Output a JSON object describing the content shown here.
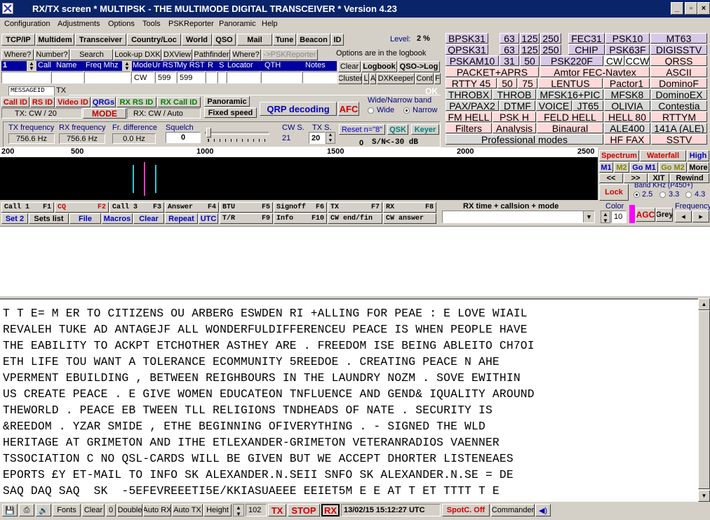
{
  "window": {
    "title": "RX/TX screen  * MULTIPSK - THE MULTIMODE DIGITAL TRANSCEIVER *   Version 4.23"
  },
  "menu": [
    "Configuration",
    "Adjustments",
    "Options",
    "Tools",
    "PSKReporter",
    "Panoramic",
    "Help"
  ],
  "toolbar1": [
    "TCP/IP",
    "Multidem",
    "Transceiver",
    "Country/Loc",
    "World",
    "QSO",
    "Mail",
    "Tune",
    "Beacon",
    "ID"
  ],
  "level": {
    "label": "Level:",
    "value": "2 %"
  },
  "toolbar2": [
    "Where?",
    "Number?",
    "Search",
    "Look-up DXK",
    "DXView",
    "Pathfinder",
    "Where?",
    "->PSKReporter"
  ],
  "logbook_note": "Options are in the logbook",
  "log_headers": {
    "num": "1",
    "call": "Call",
    "name": "Name",
    "freq": "Freq Mhz",
    "mode": "Mode",
    "ur": "Ur RST",
    "my": "My RST",
    "r": "R",
    "s": "S",
    "locator": "Locator",
    "qth": "QTH",
    "notes": "Notes"
  },
  "log_values": {
    "mode": "CW",
    "ur": "599",
    "my": "599"
  },
  "log_buttons": {
    "clear": "Clear",
    "logbook": "Logbook",
    "qso_log": "QSO->Log",
    "cluster": "Cluster",
    "l": "L",
    "a": "A",
    "dxkeeper": "DXKeeper",
    "cont": "Cont",
    "f": "F"
  },
  "tabs": [
    "MESSAGEID",
    "TX"
  ],
  "ids": {
    "call": "Call ID",
    "rs": "RS ID",
    "video": "Video ID",
    "qrgs": "QRGs",
    "rx_rs": "RX RS ID",
    "rx_call": "RX Call ID",
    "panoramic": "Panoramic",
    "fixed": "Fixed speed"
  },
  "tx_status": "TX: CW / 20",
  "mode_btn": "MODE",
  "rx_status": "RX: CW / Auto",
  "qrp": "QRP decoding",
  "afc": "AFC",
  "band": {
    "title": "Wide/Narrow band",
    "wide": "Wide",
    "narrow": "Narrow"
  },
  "ok": "OK",
  "freq": {
    "tx_label": "TX frequency",
    "tx": "756.6 Hz",
    "rx_label": "RX frequency",
    "rx": "756.6 Hz",
    "diff_label": "Fr. difference",
    "diff": "0.0 Hz",
    "squelch_label": "Squelch",
    "squelch": "0",
    "cws_label": "CW S.",
    "cws": "21",
    "txs_label": "TX S.",
    "txs": "20",
    "reset": "Reset n=\"8\"",
    "qsk": "QSK",
    "keyer": "Keyer",
    "sn0": "0",
    "sn": "S/N<-30 dB"
  },
  "modes": [
    [
      "BPSK31",
      "63",
      "125",
      "250",
      "FEC31",
      "PSK10",
      "MT63"
    ],
    [
      "QPSK31",
      "63",
      "125",
      "250",
      "CHIP",
      "PSK63F",
      "DIGISSTV"
    ],
    [
      "PSKAM10",
      "31",
      "50",
      "PSK220F",
      "CW",
      "CCW",
      "QRSS"
    ],
    [
      "PACKET+APRS",
      "Amtor FEC-Navtex",
      "ASCII"
    ],
    [
      "RTTY 45",
      "50",
      "75",
      "LENTUS",
      "Pactor1",
      "DominoF"
    ],
    [
      "THROBX",
      "THROB",
      "MFSK16+PIC",
      "MFSK8",
      "DominoEX"
    ],
    [
      "PAX/PAX2",
      "DTMF",
      "VOICE",
      "JT65",
      "OLIVIA",
      "Contestia"
    ],
    [
      "FM HELL",
      "PSK H",
      "FELD HELL",
      "HELL 80",
      "RTTYM"
    ],
    [
      "Filters",
      "Analysis",
      "Binaural",
      "ALE400",
      "141A (ALE)"
    ],
    [
      "Professional modes",
      "HF FAX",
      "SSTV"
    ]
  ],
  "ruler": [
    "200",
    "500",
    "1000",
    "1500",
    "2000",
    "2500"
  ],
  "display": {
    "spectrum": "Spectrum",
    "waterfall": "Waterfall",
    "high": "High",
    "m1": "M1",
    "m2": "M2",
    "gom1": "Go M1",
    "gom2": "Go M2",
    "more": "More",
    "left": "<<",
    "right": ">>",
    "xit": "XIT",
    "rewind": "Rewind",
    "lock": "Lock",
    "bandkhz": "Band KHz (P450+)",
    "b25": "2.5",
    "b33": "3.3",
    "b43": "4.3",
    "color": "Color",
    "color_val": "10",
    "agc": "AGC",
    "grey": "Grey",
    "frequency": "Frequency"
  },
  "fkeys": [
    {
      "l": "Call  1",
      "r": "F1"
    },
    {
      "l": "CQ",
      "r": "F2"
    },
    {
      "l": "Call  3",
      "r": "F3"
    },
    {
      "l": "Answer",
      "r": "F4"
    },
    {
      "l": "BTU",
      "r": "F5"
    },
    {
      "l": "Signoff",
      "r": "F6"
    },
    {
      "l": "TX",
      "r": "F7"
    },
    {
      "l": "RX",
      "r": "F8"
    },
    {
      "l": "T/R",
      "r": "F9"
    },
    {
      "l": "Info",
      "r": "F10"
    },
    {
      "l": "CW end/fin",
      "r": ""
    },
    {
      "l": "CW answer",
      "r": ""
    }
  ],
  "bottom_btns": {
    "set2": "Set 2",
    "sets": "Sets list",
    "file": "File",
    "macros": "Macros",
    "clear": "Clear",
    "repeat": "Repeat",
    "utc": "UTC"
  },
  "rx_time": "RX time + callsion + mode",
  "rx_text": [
    "T T E= M ER TO CITIZENS OU ARBERG ESWDEN RI +ALLING FOR PEAE : E LOVE WIAIL",
    "REVALEH TUKE AD ANTAGEJF ALL WONDERFULDIFFERENCEU PEACE IS WHEN PEOPLE HAVE",
    "THE EABILITY TO ACKPT ETCHOTHER ASTHEY ARE . FREEDOM ISE BEING ABLEITO CH7OI",
    "ETH LIFE TOU WANT A TOLERANCE ECOMMUNITY 5REEDOE . CREATING PEACE N AHE",
    "VPERMENT EBUILDING , BETWEEN REIGHBOURS IN THE LAUNDRY NOZM . SOVE EWITHIN",
    "US CREATE PEACE . E GIVE WOMEN EDUCATEON TNFLUENCE AND GEND& IQUALITY AROUND",
    "THEWORLD . PEACE EB TWEEN TLL RELIGIONS TNDHEADS OF NATE . SECURITY IS",
    "&REEDOM . YZAR SMIDE , ETHE BEGINNING OFIVERYTHING . - SIGNED THE WLD",
    "HERITAGE AT GRIMETON AND ITHE ETLEXANDER-GRIMETON VETERANRADIOS VAENNER",
    "TSSOCIATION C NO QSL-CARDS WILL BE GIVEN BUT WE ACCEPT DHORTER LISTENEAES",
    "EPORTS £Y ET-MAIL TO INFO SK ALEXANDER.N.SEII SNFO SK ALEXANDER.N.SE = DE",
    "SAQ DAQ SAQ  SK  -5EFEVREEETI5E/KKIASUAEEE EEIET5M E E AT T ET TTTT T E"
  ],
  "status": {
    "fonts": "Fonts",
    "clear": "Clear",
    "zero": "0",
    "double": "Double",
    "autorx": "Auto RX",
    "autotx": "Auto TX",
    "height": "Height",
    "height_val": "102",
    "tx": "TX",
    "stop": "STOP",
    "rx": "RX",
    "datetime": "13/02/15 15:12:27 UTC",
    "spotc": "SpotC. Off",
    "commander": "Commander"
  }
}
